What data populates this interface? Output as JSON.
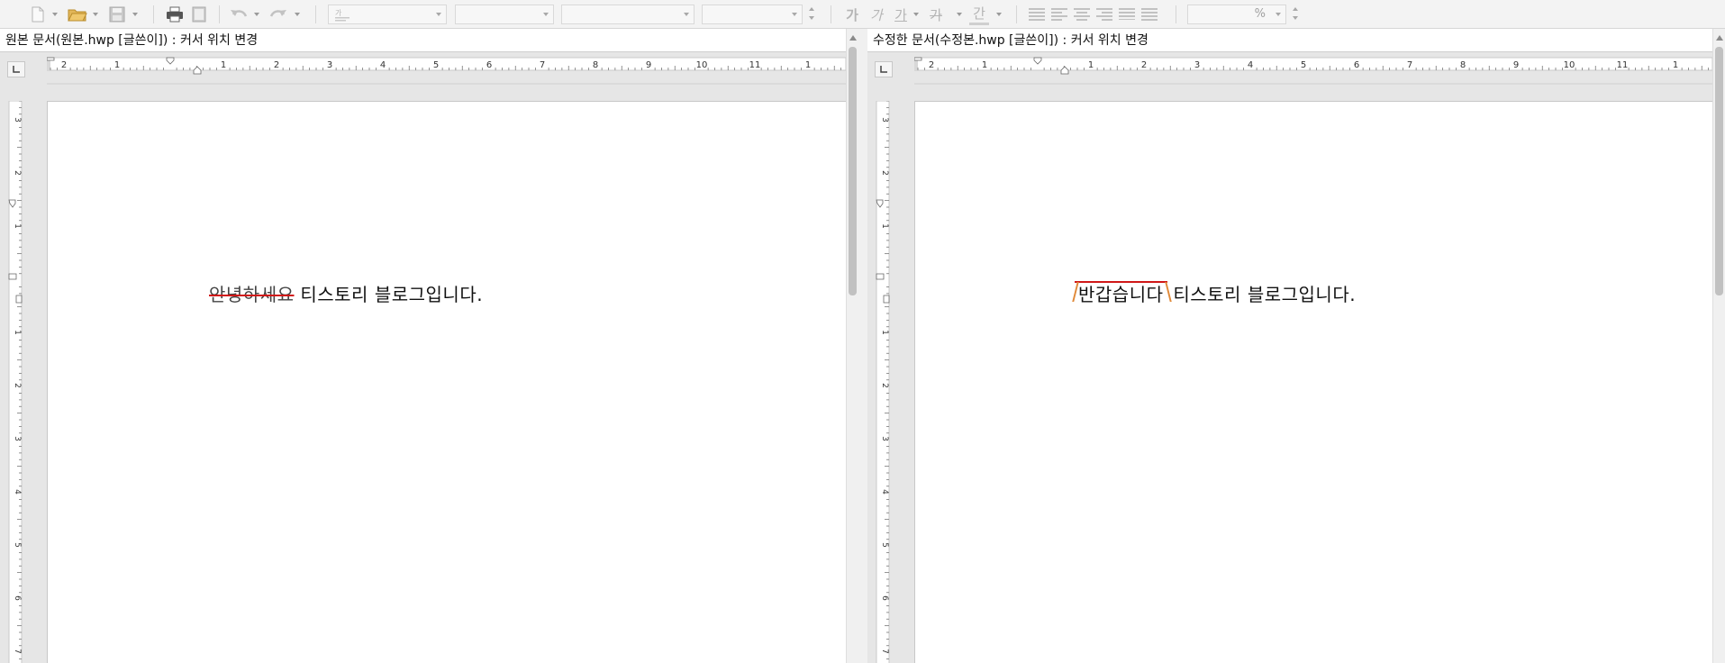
{
  "toolbar": {
    "icons": [
      "new-document-icon",
      "open-folder-icon",
      "save-icon",
      "print-icon",
      "print-preview-icon",
      "undo-icon",
      "redo-icon",
      "style-icon",
      "bold-icon",
      "italic-icon",
      "underline-icon",
      "strikethrough-icon",
      "text-color-icon",
      "align-justify-icon",
      "align-left-icon",
      "align-center-icon",
      "align-right-icon",
      "distribute-icon",
      "divide-icon"
    ],
    "bold_glyph": "가",
    "italic_glyph": "가",
    "underline_glyph": "가",
    "strike_glyph": "가",
    "color_glyph": "간",
    "zoom_unit": "%"
  },
  "left_pane": {
    "title": "원본 문서(원본.hwp [글쓴이]) : 커서 위치 변경",
    "doc": {
      "deleted_text": "안녕하세요",
      "rest_text": " 티스토리 블로그입니다."
    }
  },
  "right_pane": {
    "title": "수정한 문서(수정본.hwp [글쓴이]) : 커서 위치 변경",
    "doc": {
      "inserted_text": "반갑습니다",
      "rest_text": " 티스토리 블로그입니다."
    }
  },
  "ruler": {
    "h_labels": [
      "2",
      "1",
      "1",
      "2",
      "3",
      "4",
      "5",
      "6",
      "7",
      "8",
      "9",
      "10",
      "11",
      "1"
    ],
    "v_labels": [
      "3",
      "2",
      "1",
      "1",
      "2",
      "3",
      "4",
      "5",
      "6",
      "7"
    ]
  },
  "colors": {
    "change_mark": "#d01818",
    "insert_bracket": "#e08a3a"
  }
}
